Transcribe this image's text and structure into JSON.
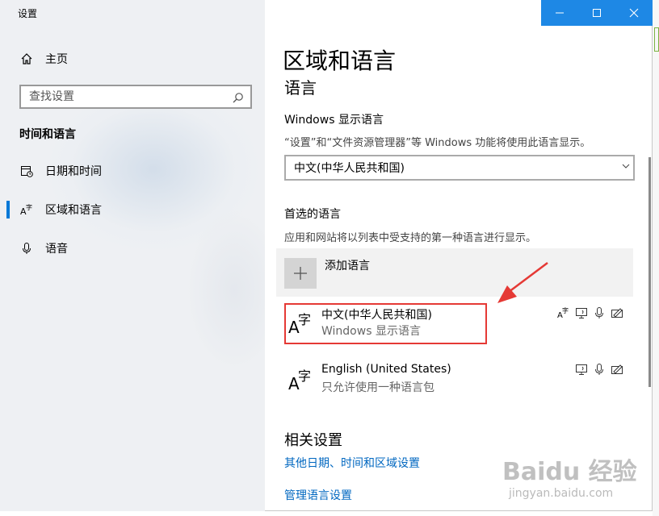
{
  "window": {
    "app_title": "设置"
  },
  "sidebar": {
    "home_label": "主页",
    "search_placeholder": "查找设置",
    "section_title": "时间和语言",
    "items": [
      {
        "label": "日期和时间",
        "icon": "calendar-clock-icon"
      },
      {
        "label": "区域和语言",
        "icon": "language-icon",
        "active": true
      },
      {
        "label": "语音",
        "icon": "microphone-icon"
      }
    ]
  },
  "main": {
    "page_title": "区域和语言",
    "sub_title": "语言",
    "display_language": {
      "label": "Windows 显示语言",
      "description": "“设置”和“文件资源管理器”等 Windows 功能将使用此语言显示。",
      "selected": "中文(中华人民共和国)"
    },
    "preferred": {
      "label": "首选的语言",
      "description": "应用和网站将以列表中受支持的第一种语言进行显示。",
      "add_label": "添加语言",
      "languages": [
        {
          "name": "中文(中华人民共和国)",
          "status": "Windows 显示语言",
          "features": [
            "language-pack-icon",
            "text-to-speech-icon",
            "speech-icon",
            "handwriting-icon"
          ]
        },
        {
          "name": "English (United States)",
          "status": "只允许使用一种语言包",
          "features": [
            "text-to-speech-icon",
            "speech-icon",
            "handwriting-icon"
          ]
        }
      ]
    },
    "related": {
      "title": "相关设置",
      "links": [
        "其他日期、时间和区域设置",
        "管理语言设置"
      ]
    }
  },
  "watermark": {
    "line1": "Baidu 经验",
    "line2": "jingyan.baidu.com"
  },
  "colors": {
    "accent": "#0078d7",
    "link": "#0067c0",
    "highlight": "#e53935",
    "titlebar_button": "#1e88e5"
  }
}
